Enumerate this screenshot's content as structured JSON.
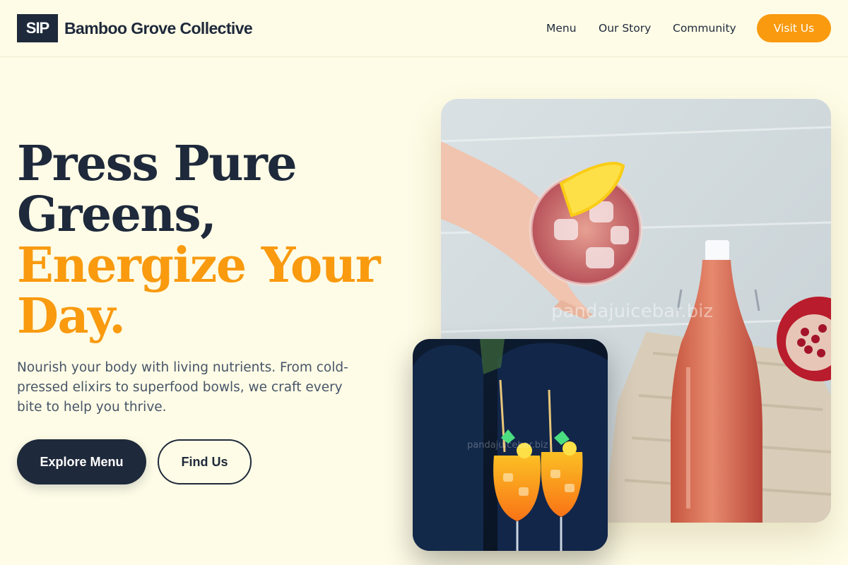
{
  "header": {
    "logo_text": "SIP",
    "brand_name": "Bamboo Grove Collective",
    "nav": [
      {
        "label": "Menu"
      },
      {
        "label": "Our Story"
      },
      {
        "label": "Community"
      }
    ],
    "cta_label": "Visit Us"
  },
  "hero": {
    "title_line1": "Press Pure",
    "title_line2": "Greens,",
    "title_line3": "Energize Your",
    "title_line4": "Day.",
    "description": "Nourish your body with living nutrients. From cold-pressed elixirs to superfood bowls, we craft every bite to help you thrive.",
    "primary_button": "Explore Menu",
    "secondary_button": "Find Us"
  },
  "images": {
    "main_watermark": "pandajuicebar.biz",
    "small_watermark": "pandajuicebar.biz"
  },
  "colors": {
    "background": "#fefce6",
    "dark": "#1e293b",
    "accent": "#f99a0f",
    "body_text": "#475569"
  }
}
